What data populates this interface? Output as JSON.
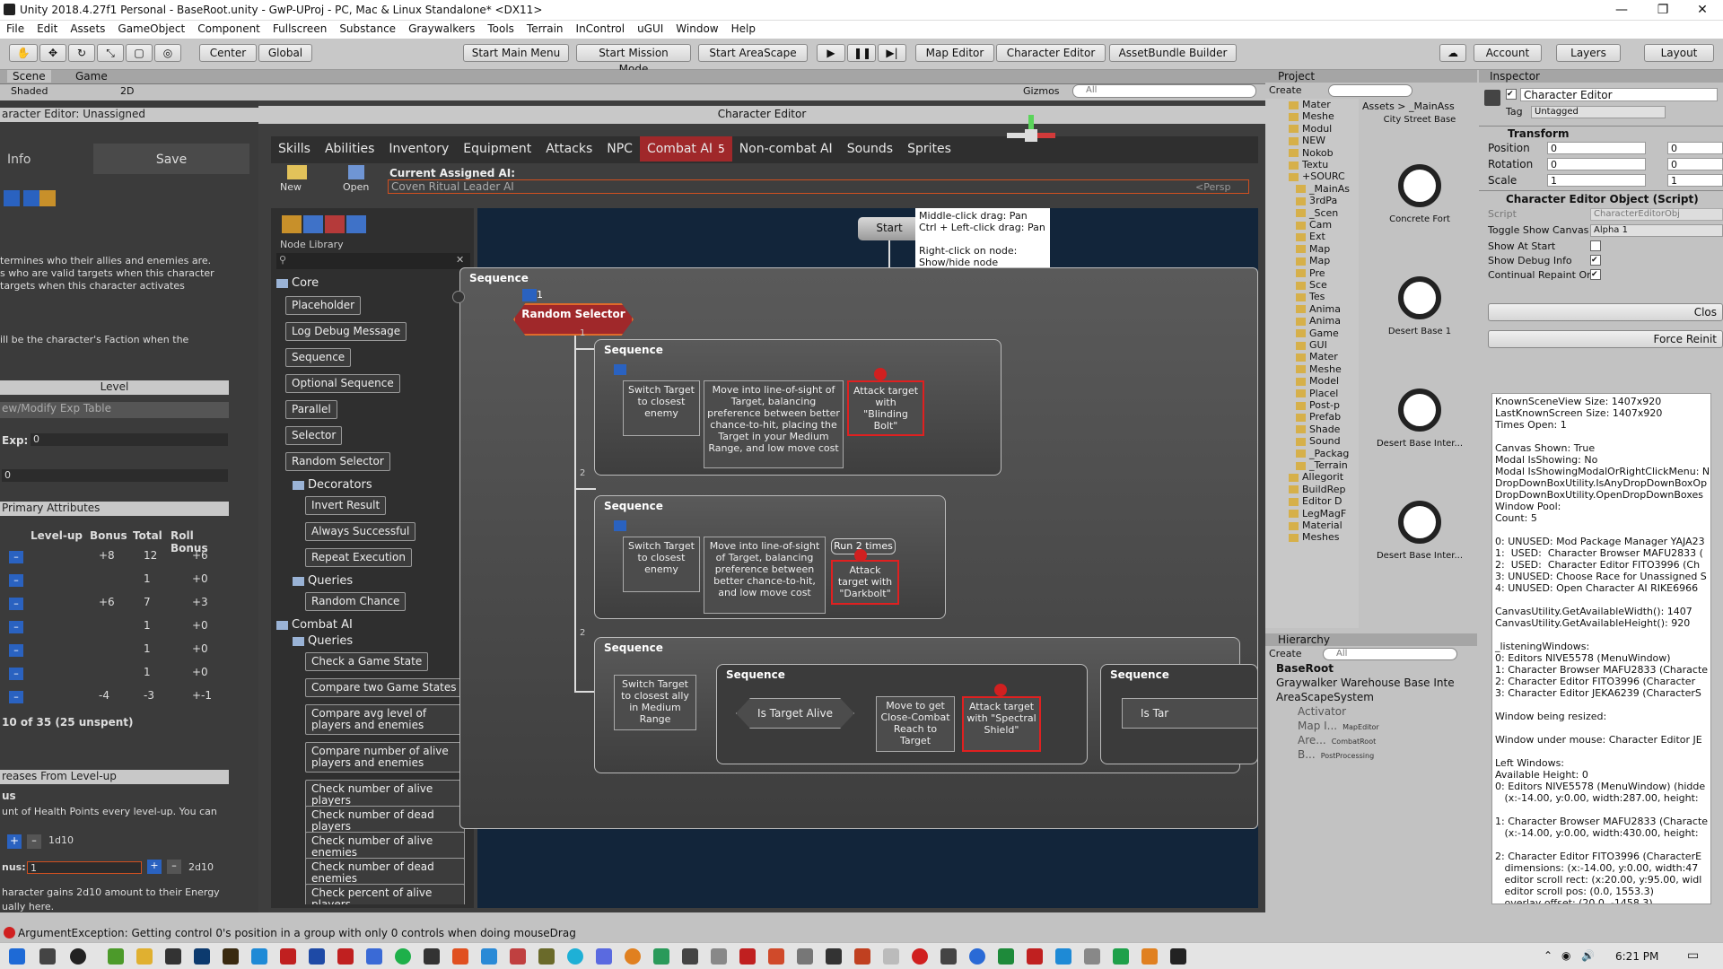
{
  "window": {
    "title": "Unity 2018.4.27f1 Personal - BaseRoot.unity - GwP-UProj - PC, Mac & Linux Standalone* <DX11>",
    "min": "—",
    "max": "❐",
    "close": "✕"
  },
  "menu": [
    "File",
    "Edit",
    "Assets",
    "GameObject",
    "Component",
    "Fullscreen",
    "Substance",
    "Graywalkers",
    "Tools",
    "Terrain",
    "InControl",
    "uGUI",
    "Window",
    "Help"
  ],
  "toolbar": {
    "center": "Center",
    "global": "Global",
    "start_main_menu": "Start Main Menu",
    "start_mission_mode": "Start Mission Mode",
    "start_areascape": "Start AreaScape",
    "map_editor": "Map Editor",
    "character_editor": "Character Editor",
    "assetbundle": "AssetBundle Builder",
    "account": "Account",
    "layers": "Layers",
    "layout": "Layout"
  },
  "scene_tabs": {
    "scene": "Scene",
    "game": "Game",
    "shaded": "Shaded",
    "twod": "2D",
    "gizmos": "Gizmos",
    "search_ph": "All"
  },
  "left": {
    "header": "aracter Editor: Unassigned",
    "info": "Info",
    "save": "Save",
    "desc": "termines who their allies and enemies are.\ns who are valid targets when this character\ntargets when this character activates",
    "desc2": "ill be the character's Faction when the",
    "level": "Level",
    "exp_table": "ew/Modify Exp Table",
    "exp_label": "Exp:",
    "exp_val": "0",
    "zero": "0",
    "primary": "Primary Attributes",
    "cols": [
      "Level-up",
      "Bonus",
      "Total",
      "Roll Bonus"
    ],
    "rows": [
      [
        "+8",
        "12",
        "+6"
      ],
      [
        "",
        "1",
        "+0"
      ],
      [
        "+6",
        "7",
        "+3"
      ],
      [
        "",
        "1",
        "+0"
      ],
      [
        "",
        "1",
        "+0"
      ],
      [
        "",
        "1",
        "+0"
      ],
      [
        "-4",
        "-3",
        "+-1"
      ]
    ],
    "unspent": "10 of 35 (25 unspent)",
    "increases": "reases From Level-up",
    "us": "us",
    "health": "unt of Health Points every level-up. You can",
    "dice1": "1d10",
    "bonus_label": "nus:",
    "bonus_val": "1",
    "dice2": "2d10",
    "gains": "haracter gains 2d10 amount to their Energy",
    "ually": "ually here."
  },
  "ce": {
    "title": "Character Editor",
    "tabs": [
      "Skills",
      "Abilities",
      "Inventory",
      "Equipment",
      "Attacks",
      "NPC",
      "Combat AI",
      "Non-combat AI",
      "Sounds",
      "Sprites"
    ],
    "combat_badge": "5",
    "new": "New",
    "open": "Open",
    "cur_label": "Current Assigned AI:",
    "cur_val": "Coven Ritual Leader AI",
    "persp": "<Persp",
    "node_library": "Node Library"
  },
  "library": {
    "core": "Core",
    "core_items": [
      "Placeholder",
      "Log Debug Message",
      "Sequence",
      "Optional Sequence",
      "Parallel",
      "Selector",
      "Random Selector"
    ],
    "decorators": "Decorators",
    "decor_items": [
      "Invert Result",
      "Always Successful",
      "Repeat Execution"
    ],
    "queries": "Queries",
    "query_items": [
      "Random Chance"
    ],
    "combat": "Combat AI",
    "combat_queries": "Queries",
    "combat_items": [
      "Check a Game State",
      "Compare two Game States",
      "Compare avg level of players and enemies",
      "Compare number of alive players and enemies",
      "Check number of alive players",
      "Check number of dead players",
      "Check number of alive enemies",
      "Check number of dead enemies",
      "Check percent of alive players"
    ]
  },
  "graph": {
    "start": "Start",
    "help": "Middle-click drag: Pan\nCtrl + Left-click drag: Pan\n\nRight-click on node:\nShow/hide node\nproperties",
    "seq": "Sequence",
    "random_selector": "Random Selector",
    "badge1": "1",
    "idx1": "1",
    "idx2": "2",
    "idx3": "2",
    "r1": {
      "switch": "Switch Target to closest enemy",
      "move": "Move into line-of-sight of Target, balancing preference between better chance-to-hit, placing the Target in your Medium Range, and low move cost",
      "attack": "Attack target with \"Blinding Bolt\""
    },
    "r2": {
      "switch": "Switch Target to closest enemy",
      "move": "Move into line-of-sight of Target, balancing preference between better chance-to-hit, and low move cost",
      "run": "Run 2 times",
      "attack": "Attack target with \"Darkbolt\""
    },
    "r3": {
      "switch": "Switch Target to closest ally in Medium Range",
      "alive": "Is Target Alive",
      "move": "Move to get Close-Combat Reach to Target",
      "attack": "Attack target with \"Spectral Shield\"",
      "alive2": "Is Tar"
    }
  },
  "project": {
    "tab": "Project",
    "create": "Create",
    "path": "Assets > _MainAss",
    "tree": [
      "Mater",
      "Meshe",
      "Modul",
      "NEW",
      "Nokob",
      "Textu",
      "+SOURC",
      "_MainAs",
      "3rdPa",
      "_Scen",
      "Cam",
      "Ext",
      "Map",
      "Map",
      "Pre",
      "Sce",
      "Tes",
      "Anima",
      "Anima",
      "Game",
      "GUI",
      "Mater",
      "Meshe",
      "Model",
      "Placel",
      "Post-p",
      "Prefab",
      "Shade",
      "Sound",
      "_Packag",
      "_Terrain",
      "Allegorit",
      "BuildRep",
      "Editor D",
      "LegMagF",
      "Material",
      "Meshes"
    ],
    "assets": [
      "City Street Base",
      "Concrete Fort",
      "Desert Base 1",
      "Desert Base Inter...",
      "Desert Base Inter..."
    ]
  },
  "hierarchy": {
    "tab": "Hierarchy",
    "create": "Create",
    "search": "All",
    "items": [
      "BaseRoot",
      "Graywalker Warehouse Base Inte",
      "AreaScapeSystem",
      "Activator",
      "Map I...",
      "Are...",
      "B..."
    ],
    "sub": [
      "",
      "",
      "",
      "",
      "MapEditor",
      "CombatRoot",
      "PostProcessing"
    ]
  },
  "inspector": {
    "tab": "Inspector",
    "name": "Character Editor",
    "tag_label": "Tag",
    "tag": "Untagged",
    "transform": "Transform",
    "position": "Position",
    "rotation": "Rotation",
    "scale": "Scale",
    "x0": "0",
    "y0": "0",
    "x1": "1",
    "y1": "1",
    "component": "Character Editor Object (Script)",
    "script_label": "Script",
    "script": "CharacterEditorObj",
    "toggle_label": "Toggle Show Canvas",
    "toggle_val": "Alpha 1",
    "show_at_start": "Show At Start",
    "show_debug": "Show Debug Info",
    "continual": "Continual Repaint Or",
    "close": "Clos",
    "force": "Force Reinit",
    "log": "KnownSceneView Size: 1407x920\nLastKnownScreen Size: 1407x920\nTimes Open: 1\n\nCanvas Shown: True\nModal IsShowing: No\nModal IsShowingModalOrRightClickMenu: N\nDropDownBoxUtility.IsAnyDropDownBoxOp\nDropDownBoxUtility.OpenDropDownBoxes\nWindow Pool:\nCount: 5\n\n0: UNUSED: Mod Package Manager YAJA23\n1:  USED:  Character Browser MAFU2833 (\n2:  USED:  Character Editor FITO3996 (Ch\n3: UNUSED: Choose Race for Unassigned S\n4: UNUSED: Open Character AI RIKE6966\n\nCanvasUtility.GetAvailableWidth(): 1407\nCanvasUtility.GetAvailableHeight(): 920\n\n_listeningWindows:\n0: Editors NIVE5578 (MenuWindow)\n1: Character Browser MAFU2833 (Characte\n2: Character Editor FITO3996 (Character\n3: Character Editor JEKA6239 (CharacterS\n\nWindow being resized:\n\nWindow under mouse: Character Editor JE\n\nLeft Windows:\nAvailable Height: 0\n0: Editors NIVE5578 (MenuWindow) (hidde\n   (x:-14.00, y:0.00, width:287.00, height:\n\n1: Character Browser MAFU2833 (Characte\n   (x:-14.00, y:0.00, width:430.00, height:\n\n2: Character Editor FITO3996 (CharacterE\n   dimensions: (x:-14.00, y:0.00, width:47\n   editor scroll rect: (x:20.00, y:95.00, widl\n   editor scroll pos: (0.0, 1553.3)\n   overlay offset: (20.0, -1458.3)"
  },
  "status": {
    "error": "ArgumentException: Getting control 0's position in a group with only 0 controls when doing mouseDrag"
  },
  "taskbar": {
    "time": "6:21 PM"
  }
}
